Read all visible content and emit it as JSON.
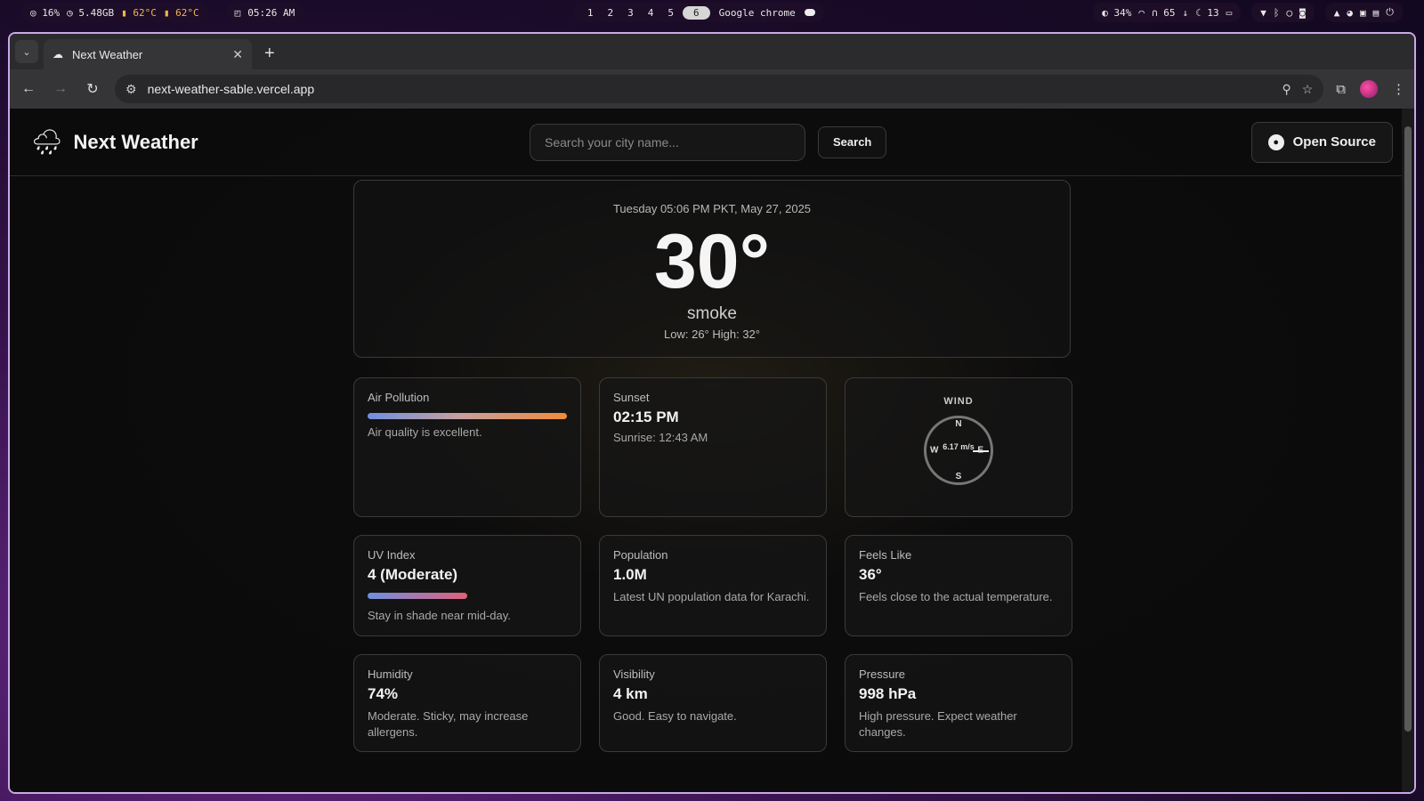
{
  "system_bar": {
    "cpu": "16%",
    "mem": "5.48GB",
    "temp1": "62°C",
    "temp2": "62°C",
    "clock": "05:26 AM",
    "workspaces": [
      "1",
      "2",
      "3",
      "4",
      "5",
      "6"
    ],
    "active_app": "Google chrome",
    "brightness": "34%",
    "headphones": "65",
    "night": "13"
  },
  "browser": {
    "tab_title": "Next Weather",
    "url": "next-weather-sable.vercel.app"
  },
  "app": {
    "name": "Next Weather",
    "search_placeholder": "Search your city name...",
    "search_button": "Search",
    "open_source": "Open Source"
  },
  "current": {
    "datetime": "Tuesday 05:06 PM PKT, May 27, 2025",
    "temperature": "30°",
    "condition": "smoke",
    "range": "Low: 26° High: 32°"
  },
  "cards": {
    "air": {
      "label": "Air Pollution",
      "desc": "Air quality is excellent."
    },
    "sunset": {
      "label": "Sunset",
      "value": "02:15 PM",
      "desc": "Sunrise: 12:43 AM"
    },
    "wind": {
      "label": "WIND",
      "speed": "6.17 m/s",
      "n": "N",
      "s": "S",
      "e": "E",
      "w": "W"
    },
    "uv": {
      "label": "UV Index",
      "value": "4 (Moderate)",
      "desc": "Stay in shade near mid-day."
    },
    "population": {
      "label": "Population",
      "value": "1.0M",
      "desc": "Latest UN population data for Karachi."
    },
    "feels": {
      "label": "Feels Like",
      "value": "36°",
      "desc": "Feels close to the actual temperature."
    },
    "humidity": {
      "label": "Humidity",
      "value": "74%",
      "desc": "Moderate. Sticky, may increase allergens."
    },
    "visibility": {
      "label": "Visibility",
      "value": "4 km",
      "desc": "Good. Easy to navigate."
    },
    "pressure": {
      "label": "Pressure",
      "value": "998 hPa",
      "desc": "High pressure. Expect weather changes."
    }
  }
}
